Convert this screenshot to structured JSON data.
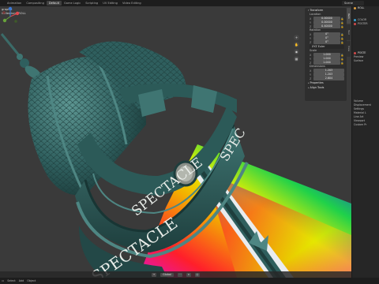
{
  "topbar": {
    "tabs": [
      {
        "label": "Animation",
        "active": false
      },
      {
        "label": "Compositing",
        "active": false
      },
      {
        "label": "Default",
        "active": true
      },
      {
        "label": "Game Logic",
        "active": false
      },
      {
        "label": "Scripting",
        "active": false
      },
      {
        "label": "UV Editing",
        "active": false
      },
      {
        "label": "Video Editing",
        "active": false
      }
    ],
    "scene": "Scene"
  },
  "viewport": {
    "header_lines": [
      "graphic",
      "Collection | ROLL"
    ],
    "billboard_text_top": "SPECTACLE",
    "billboard_text_bottom": "SPECTACLE",
    "billboard_text_side": "SPEC"
  },
  "npanel": {
    "transform_label": "Transform",
    "location_label": "Location",
    "location": {
      "x": "0.00000",
      "y": "0.00000",
      "z": "0.40000"
    },
    "rotation_label": "Rotation",
    "rotation": {
      "x": "0°",
      "y": "0°",
      "z": "0°"
    },
    "rotation_mode": "XYZ Euler",
    "scale_label": "Scale",
    "scale": {
      "x": "1.000",
      "y": "1.000",
      "z": "1.000"
    },
    "dimensions_label": "Dimensions",
    "dimensions": {
      "x": "1.203",
      "y": "1.203",
      "z": "2.604"
    },
    "properties_label": "Properties",
    "align_tools_label": "Align Tools"
  },
  "vtabs": [
    "Item",
    "Tool",
    "View"
  ],
  "rightpanel": {
    "rows": [
      "ROLL",
      "COLOR",
      "POSTER"
    ],
    "sections": [
      "POSTE",
      "Preview",
      "Surface",
      "Volume",
      "Displacement",
      "Settings",
      "Material L",
      "Line Art",
      "Viewport",
      "Custom Pr"
    ]
  },
  "statusbar": {
    "items": [
      "Select",
      "Add",
      "Object"
    ]
  },
  "vpbottom": {
    "orientation": "Global"
  },
  "colors": {
    "teal": "#2f5f5e",
    "teal_dark": "#1e3e3d",
    "teal_light": "#4e8683",
    "viewport_bg": "#3a3a3a",
    "rainbow_red": "#ff1f2a",
    "rainbow_yellow": "#f3f000",
    "rainbow_green": "#1fd14a",
    "rainbow_blue": "#2a4ff0",
    "rainbow_magenta": "#e014c8"
  },
  "icons": [
    "grid-icon",
    "hand-icon",
    "camera-icon",
    "search-icon",
    "lock-icon",
    "gear-icon",
    "eye-icon"
  ]
}
